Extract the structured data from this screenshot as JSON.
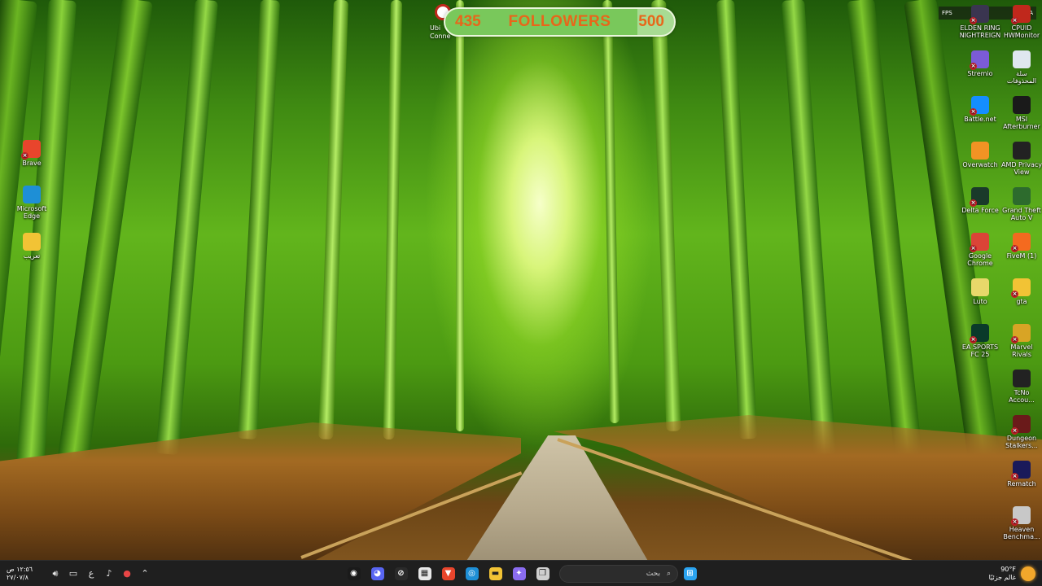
{
  "followers_widget": {
    "current": "435",
    "label": "FOLLOWERS",
    "goal": "500",
    "left_icon_label": "Ubi Conne"
  },
  "fps_overlay": {
    "label": "FPS",
    "value": "N/A"
  },
  "desktop_icons_left": [
    {
      "label": "Brave",
      "icon": "brave-icon",
      "color": "#e8452c"
    },
    {
      "label": "Microsoft Edge",
      "icon": "edge-icon",
      "color": "#1e8fd6"
    },
    {
      "label": "تعريب",
      "icon": "folder-icon",
      "color": "#f2c335"
    }
  ],
  "desktop_icons_right": [
    {
      "label": "ELDEN RING NIGHTREIGN",
      "icon": "elden-ring-icon",
      "color": "#3a3550"
    },
    {
      "label": "CPUID HWMonitor",
      "icon": "hwmonitor-icon",
      "color": "#c0281c"
    },
    {
      "label": "Stremio",
      "icon": "stremio-icon",
      "color": "#7b5bd6"
    },
    {
      "label": "سلة المحذوفات",
      "icon": "recycle-bin-icon",
      "color": "#dfe7ef"
    },
    {
      "label": "Battle.net",
      "icon": "battlenet-icon",
      "color": "#148eff"
    },
    {
      "label": "MSI Afterburner",
      "icon": "afterburner-icon",
      "color": "#1a1a1a"
    },
    {
      "label": "Overwatch",
      "icon": "overwatch-icon",
      "color": "#f29324"
    },
    {
      "label": "AMD Privacy View",
      "icon": "amd-eye-icon",
      "color": "#222222"
    },
    {
      "label": "Delta Force",
      "icon": "delta-force-icon",
      "color": "#1a3a2a"
    },
    {
      "label": "Grand Theft Auto V",
      "icon": "gta-v-icon",
      "color": "#2d6b2d"
    },
    {
      "label": "Google Chrome",
      "icon": "chrome-icon",
      "color": "#db4437"
    },
    {
      "label": "FiveM (1)",
      "icon": "fivem-icon",
      "color": "#f46a1f"
    },
    {
      "label": "Luto",
      "icon": "luto-icon",
      "color": "#e8d86a"
    },
    {
      "label": "gta",
      "icon": "folder-icon",
      "color": "#f2c335"
    },
    {
      "label": "EA SPORTS FC 25",
      "icon": "ea-fc-icon",
      "color": "#0a3a2a"
    },
    {
      "label": "Marvel Rivals",
      "icon": "marvel-rivals-icon",
      "color": "#d8a425"
    },
    {
      "label": "TcNo Accou...",
      "icon": "tcno-icon",
      "color": "#222222"
    },
    {
      "label": "Dungeon Stalkers...",
      "icon": "dungeon-stalkers-icon",
      "color": "#6a1a1a"
    },
    {
      "label": "Rematch",
      "icon": "rematch-icon",
      "color": "#1a1a5a"
    },
    {
      "label": "Heaven Benchma...",
      "icon": "heaven-benchmark-icon",
      "color": "#c8c8c8"
    }
  ],
  "taskbar": {
    "clock_time": "١٢:٥٦ ص",
    "clock_date": "٢٧/٠٧/٨",
    "language": "ع",
    "tray_icons": [
      "volume-icon",
      "network-icon",
      "microphone-icon",
      "tray-app-icon",
      "chevron-up-icon"
    ],
    "apps": [
      {
        "name": "obs-icon",
        "color": "#1a1a1a",
        "glyph": "◉"
      },
      {
        "name": "discord-icon",
        "color": "#5865f2",
        "glyph": "◕"
      },
      {
        "name": "xbox-app-icon",
        "color": "#2a2a2a",
        "glyph": "⊘"
      },
      {
        "name": "microsoft-store-icon",
        "color": "#e8e8e8",
        "glyph": "▦"
      },
      {
        "name": "brave-icon",
        "color": "#e8452c",
        "glyph": "▼"
      },
      {
        "name": "edge-icon",
        "color": "#1e8fd6",
        "glyph": "◎"
      },
      {
        "name": "file-explorer-icon",
        "color": "#f2c335",
        "glyph": "▬"
      },
      {
        "name": "copilot-icon",
        "color": "#8a6cf0",
        "glyph": "✦"
      },
      {
        "name": "task-view-icon",
        "color": "#cfcfcf",
        "glyph": "❐"
      }
    ],
    "search_placeholder": "بحث",
    "weather_temp": "90°F",
    "weather_desc": "غالم جزئيًا"
  }
}
